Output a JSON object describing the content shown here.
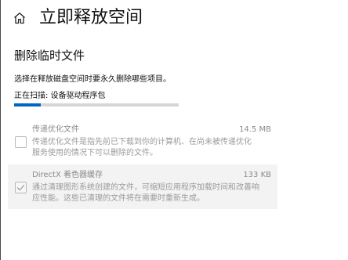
{
  "header": {
    "home_icon": "home-icon",
    "title": "立即释放空间"
  },
  "section": {
    "title": "删除临时文件",
    "instruction": "选择在释放磁盘空间时要永久删除哪些项目。",
    "scan_status": "正在扫描: 设备驱动程序包",
    "progress_fraction": 0.16,
    "accent_color": "#0067c0"
  },
  "items": [
    {
      "name": "传递优化文件",
      "size": "14.5 MB",
      "checked": false,
      "description_lines": [
        "传递优化文件是指先前已下载到你的计算机、在尚未被传递优化",
        "服务使用的情况下可以删除的文件。"
      ]
    },
    {
      "name": "DirectX 着色器缓存",
      "size": "133 KB",
      "checked": true,
      "description_lines": [
        "通过清理图形系统创建的文件，可缩短应用程序加载时间和改善响",
        "应性能。这些已清理的文件将在需要时重新生成。"
      ]
    }
  ]
}
